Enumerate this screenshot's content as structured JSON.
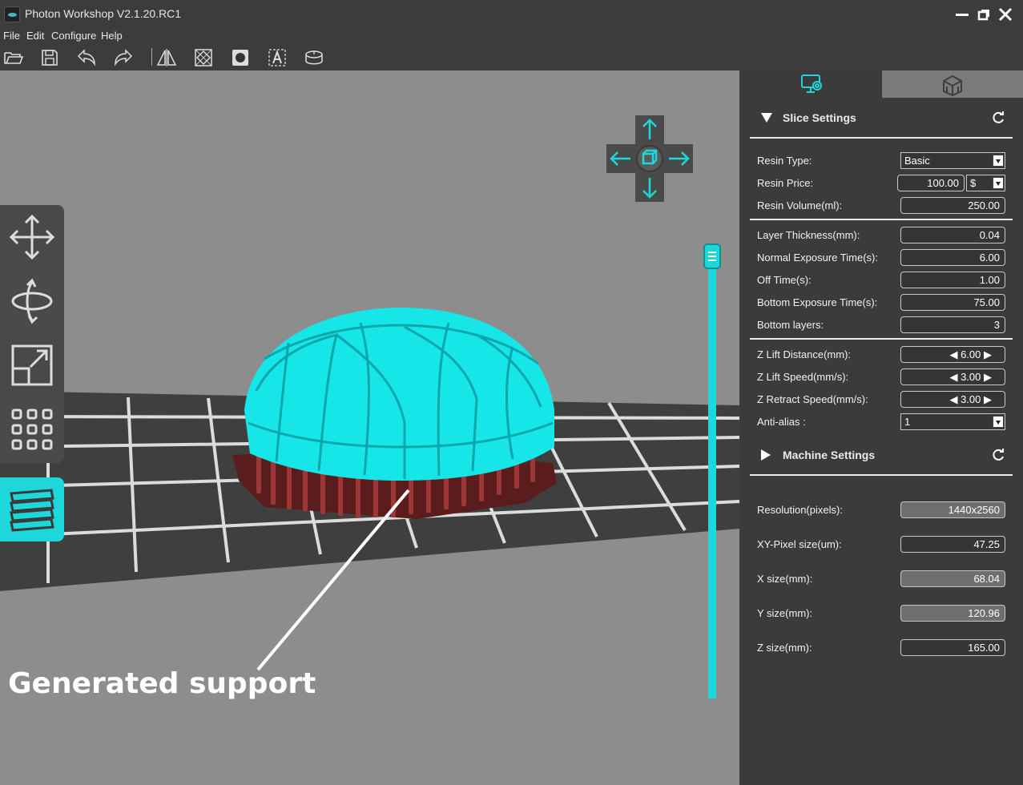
{
  "window": {
    "title": "Photon Workshop V2.1.20.RC1"
  },
  "menu": [
    "File",
    "Edit",
    "Configure",
    "Help"
  ],
  "toolbar": {
    "tools": [
      "open-icon",
      "save-icon",
      "undo-icon",
      "redo-icon",
      "mirror-icon",
      "hollow-icon",
      "punch-hole-icon",
      "text-icon",
      "slice-icon"
    ]
  },
  "left_tools": [
    "move-icon",
    "rotate-icon",
    "scale-icon",
    "arrange-icon",
    "layers-icon"
  ],
  "annotation": "Generated support",
  "colors": {
    "accent": "#1ed7da",
    "model": "#17e6e8",
    "support": "#8a2a2a",
    "viewport": "#8d8d8d",
    "panel": "#3b3b3b"
  },
  "slice_settings": {
    "title": "Slice Settings",
    "resin_type_label": "Resin Type:",
    "resin_type": "Basic",
    "resin_price_label": "Resin Price:",
    "resin_price": "100.00",
    "currency": "$",
    "resin_volume_label": "Resin Volume(ml):",
    "resin_volume": "250.00",
    "layer_thickness_label": "Layer Thickness(mm):",
    "layer_thickness": "0.04",
    "normal_exposure_label": "Normal Exposure Time(s):",
    "normal_exposure": "6.00",
    "off_time_label": "Off Time(s):",
    "off_time": "1.00",
    "bottom_exposure_label": "Bottom Exposure Time(s):",
    "bottom_exposure": "75.00",
    "bottom_layers_label": "Bottom layers:",
    "bottom_layers": "3",
    "z_lift_distance_label": "Z Lift Distance(mm):",
    "z_lift_distance": "6.00",
    "z_lift_speed_label": "Z Lift Speed(mm/s):",
    "z_lift_speed": "3.00",
    "z_retract_speed_label": "Z Retract Speed(mm/s):",
    "z_retract_speed": "3.00",
    "anti_alias_label": "Anti-alias :",
    "anti_alias": "1"
  },
  "machine_settings": {
    "title": "Machine Settings",
    "resolution_label": "Resolution(pixels):",
    "resolution": "1440x2560",
    "xy_pixel_label": "XY-Pixel size(um):",
    "xy_pixel": "47.25",
    "x_size_label": "X size(mm):",
    "x_size": "68.04",
    "y_size_label": "Y size(mm):",
    "y_size": "120.96",
    "z_size_label": "Z size(mm):",
    "z_size": "165.00"
  }
}
